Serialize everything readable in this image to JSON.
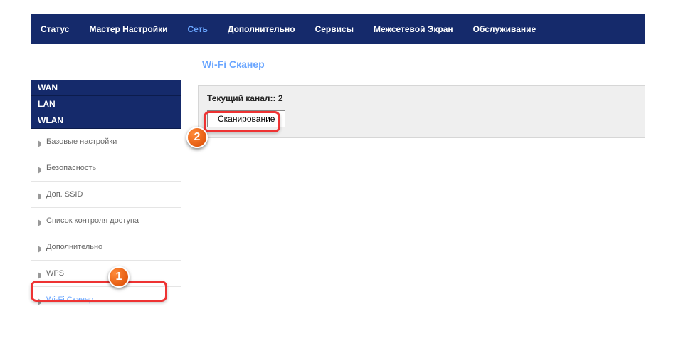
{
  "topnav": {
    "items": [
      {
        "label": "Статус"
      },
      {
        "label": "Мастер Настройки"
      },
      {
        "label": "Сеть"
      },
      {
        "label": "Дополнительно"
      },
      {
        "label": "Сервисы"
      },
      {
        "label": "Межсетевой Экран"
      },
      {
        "label": "Обслуживание"
      }
    ],
    "active_index": 2
  },
  "sidebar": {
    "top": [
      {
        "label": "WAN"
      },
      {
        "label": "LAN"
      },
      {
        "label": "WLAN"
      }
    ],
    "sub": [
      {
        "label": "Базовые настройки"
      },
      {
        "label": "Безопасность"
      },
      {
        "label": "Доп. SSID"
      },
      {
        "label": "Список контроля доступа"
      },
      {
        "label": "Дополнительно"
      },
      {
        "label": "WPS"
      },
      {
        "label": "Wi-Fi Сканер"
      }
    ],
    "active_sub_index": 6
  },
  "main": {
    "title": "Wi-Fi Сканер",
    "channel_label": "Текущий канал::",
    "channel_value": "2",
    "scan_button": "Сканирование"
  },
  "annotations": {
    "badge1": "1",
    "badge2": "2"
  }
}
